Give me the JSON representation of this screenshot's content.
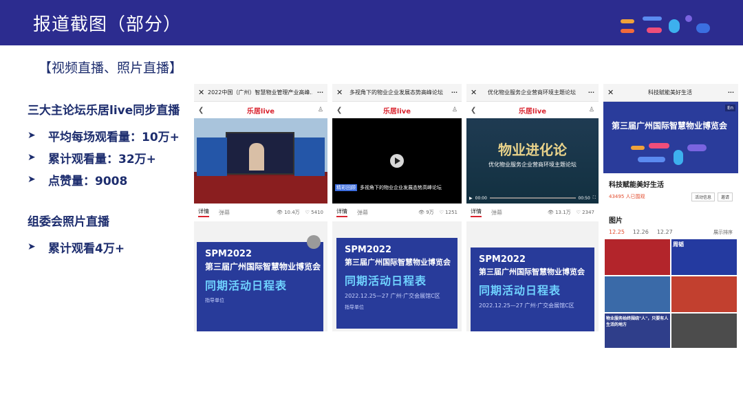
{
  "header": {
    "title": "报道截图（部分）"
  },
  "section_tag": "【视频直播、照片直播】",
  "block1": {
    "heading": "三大主论坛乐居live同步直播",
    "bullets": [
      "平均每场观看量：10万+",
      "累计观看量：32万+",
      "点赞量：9008"
    ]
  },
  "block2": {
    "heading": "组委会照片直播",
    "bullets": [
      "累计观看4万+"
    ]
  },
  "colors": {
    "header_bg": "#2c2c8f",
    "text_navy": "#1d2d6e",
    "accent_red": "#d9232e"
  },
  "bullet_icon": "arrow-right-icon",
  "phones": [
    {
      "topbar_title": "2022中国（广州）智慧物业管理产业高峰...",
      "brand": "乐居live",
      "tab_detail": "详情",
      "tab_comments": "弹幕",
      "views": "10.4万",
      "likes": "5410",
      "poster": {
        "spm": "SPM2022",
        "line1": "第三届广州国际智慧物业博览会",
        "line2": "同期活动日程表",
        "date": "",
        "guide": "指导单位"
      }
    },
    {
      "topbar_title": "多视角下的物业企业发展态势高峰论坛",
      "brand": "乐居live",
      "video_caption": "多视角下的物业企业发展态势高峰论坛",
      "video_badge": "精彩回顾",
      "tab_detail": "详情",
      "tab_comments": "弹幕",
      "views": "9万",
      "likes": "1251",
      "poster": {
        "spm": "SPM2022",
        "line1": "第三届广州国际智慧物业博览会",
        "line2": "同期活动日程表",
        "date": "2022.12.25—27  广州·广交会展馆C区",
        "guide": "指导单位"
      }
    },
    {
      "topbar_title": "优化物业服务企业营商环境主题论坛",
      "brand": "乐居live",
      "video_title": "物业进化论",
      "video_sub": "优化物业服务企业营商环境主题论坛",
      "time_start": "00:00",
      "time_end": "00:50",
      "tab_detail": "详情",
      "tab_comments": "弹幕",
      "views": "13.1万",
      "likes": "2347",
      "poster": {
        "spm": "SPM2022",
        "line1": "第三届广州国际智慧物业博览会",
        "line2": "同期活动日程表",
        "date": "2022.12.25—27  广州·广交会展馆C区",
        "guide": ""
      }
    },
    {
      "topbar_title": "科技赋能美好生活",
      "en_badge": "En",
      "banner_title": "第三届广州国际智慧物业博览会",
      "album_name": "科技赋能美好生活",
      "watch_count": "43495 人已围观",
      "btn_info": "活动信息",
      "btn_invite": "邀请",
      "section_title": "图片",
      "dates": [
        "12.25",
        "12.26",
        "12.27"
      ],
      "sort_label": "展示排序",
      "photo_captions": [
        "",
        "周韬",
        "",
        "",
        "物业服务始终围绕\"人\"，只要有人生活的地方",
        ""
      ]
    }
  ]
}
